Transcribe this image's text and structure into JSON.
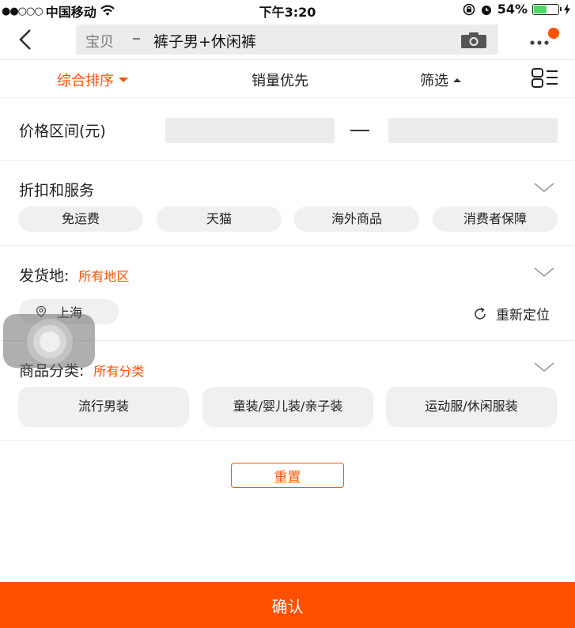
{
  "status_bar": {
    "signal": "●●○○○",
    "carrier": "中国移动",
    "time": "下午3:20",
    "battery_percent": "54%",
    "battery_level": 0.54
  },
  "search": {
    "type_label": "宝贝",
    "query": "裤子男+休闲裤"
  },
  "sort_bar": {
    "comprehensive": "综合排序",
    "sales_first": "销量优先",
    "filter": "筛选"
  },
  "price": {
    "label": "价格区间(元)",
    "min_value": "",
    "max_value": ""
  },
  "discount_service": {
    "title": "折扣和服务",
    "options": [
      "免运费",
      "天猫",
      "海外商品",
      "消费者保障"
    ]
  },
  "ship_from": {
    "title": "发货地:",
    "selected": "所有地区",
    "current_location": "上海",
    "relocate_label": "重新定位"
  },
  "category": {
    "title": "商品分类:",
    "selected": "所有分类",
    "options": [
      "流行男装",
      "童装/婴儿装/亲子装",
      "运动服/休闲服装"
    ]
  },
  "actions": {
    "reset": "重置",
    "confirm": "确认"
  },
  "colors": {
    "accent": "#ff5000",
    "chip_bg": "#f0f0f0",
    "battery_green": "#4cd964"
  }
}
